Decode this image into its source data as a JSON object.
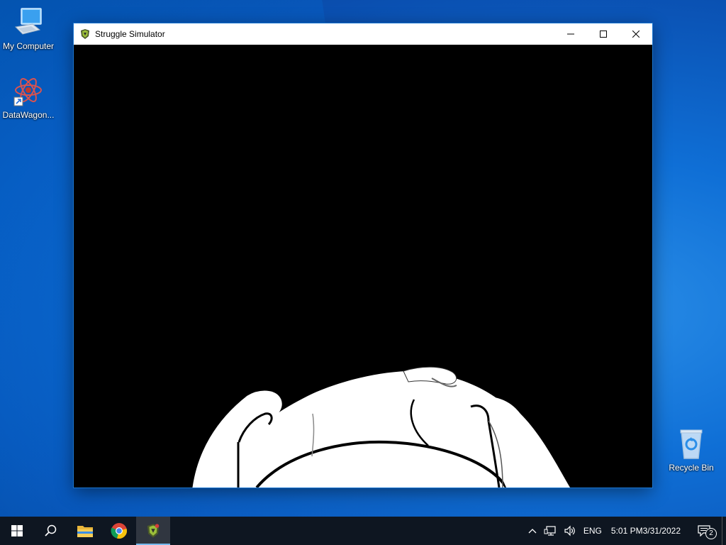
{
  "desktop": {
    "icons": [
      {
        "label": "My Computer",
        "icon": "computer-icon"
      },
      {
        "label": "DataWagon...",
        "icon": "datawagon-shortcut-icon"
      },
      {
        "label": "Recycle Bin",
        "icon": "recycle-bin-icon"
      }
    ]
  },
  "window": {
    "title": "Struggle Simulator",
    "icon": "struggle-simulator-app-icon",
    "controls": {
      "minimize": "minimize-icon",
      "maximize": "maximize-icon",
      "close": "close-icon"
    }
  },
  "game": {
    "scene": "white cartoon character bald head gripped by two hands on black background"
  },
  "taskbar": {
    "apps": [
      {
        "name": "start",
        "icon": "windows-start-icon"
      },
      {
        "name": "search",
        "icon": "search-icon"
      },
      {
        "name": "file-explorer",
        "icon": "folder-icon"
      },
      {
        "name": "chrome",
        "icon": "chrome-icon"
      },
      {
        "name": "struggle-simulator",
        "icon": "struggle-simulator-app-icon",
        "active": true
      }
    ],
    "tray": {
      "language": "ENG",
      "time": "5:01 PM",
      "date": "3/31/2022",
      "notification_count": "2"
    }
  },
  "colors": {
    "taskbar": "#0e1621",
    "desktop_accent": "#0f6fd6",
    "active_indicator": "#76b9ed"
  }
}
